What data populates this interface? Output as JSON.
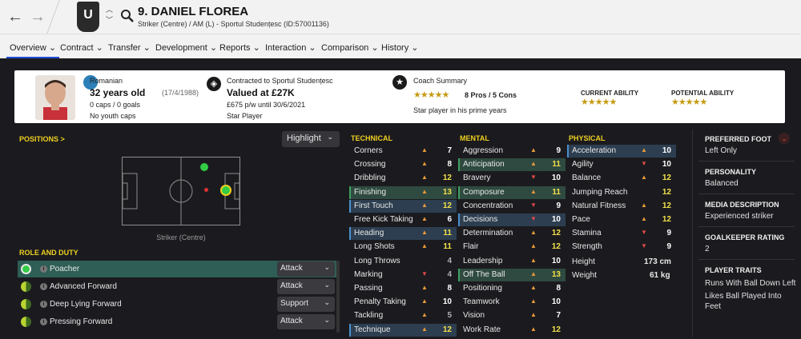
{
  "header": {
    "back_icon": "arrow-left-icon",
    "forward_icon": "arrow-right-icon",
    "club_badge_text": "U",
    "player_title": "9. DANIEL FLOREA",
    "player_subtitle": "Striker (Centre) / AM (L) - Sportul Studențesc (ID:57001136)"
  },
  "tabs": [
    {
      "label": "Overview ⌄",
      "active": true
    },
    {
      "label": "Contract ⌄"
    },
    {
      "label": "Transfer ⌄"
    },
    {
      "label": "Development ⌄"
    },
    {
      "label": "Reports ⌄"
    },
    {
      "label": "Interaction ⌄"
    },
    {
      "label": "Comparison ⌄"
    },
    {
      "label": "History ⌄"
    }
  ],
  "overview": {
    "nationality": "Romanian",
    "age": "32 years old",
    "dob": "(17/4/1988)",
    "caps": "0 caps / 0 goals",
    "youth_caps": "No youth caps",
    "contract_label": "Contracted to Sportul Studențesc",
    "value": "Valued at £27K",
    "wage": "£675 p/w until 30/6/2021",
    "status": "Star Player",
    "coach_label": "Coach Summary",
    "coach_stars": "★★★★★",
    "coach_pros_cons": "8 Pros / 5 Cons",
    "coach_text": "Star player in his prime years",
    "current_ability_label": "CURRENT ABILITY",
    "current_ability_stars": "★★★★★",
    "potential_ability_label": "POTENTIAL ABILITY",
    "potential_ability_stars": "★★★★★"
  },
  "positions": {
    "title": "POSITIONS >",
    "highlight_label": "Highlight",
    "pitch_caption": "Striker (Centre)"
  },
  "roles": {
    "title": "ROLE AND DUTY",
    "items": [
      {
        "name": "Poacher",
        "duty": "Attack"
      },
      {
        "name": "Advanced Forward",
        "duty": "Attack"
      },
      {
        "name": "Deep Lying Forward",
        "duty": "Support"
      },
      {
        "name": "Pressing Forward",
        "duty": "Attack"
      }
    ]
  },
  "technical": {
    "title": "TECHNICAL",
    "rows": [
      {
        "name": "Corners",
        "value": "7"
      },
      {
        "name": "Crossing",
        "value": "8"
      },
      {
        "name": "Dribbling",
        "value": "12"
      },
      {
        "name": "Finishing",
        "value": "13"
      },
      {
        "name": "First Touch",
        "value": "12"
      },
      {
        "name": "Free Kick Taking",
        "value": "6"
      },
      {
        "name": "Heading",
        "value": "11"
      },
      {
        "name": "Long Shots",
        "value": "11"
      },
      {
        "name": "Long Throws",
        "value": "4"
      },
      {
        "name": "Marking",
        "value": "4"
      },
      {
        "name": "Passing",
        "value": "8"
      },
      {
        "name": "Penalty Taking",
        "value": "10"
      },
      {
        "name": "Tackling",
        "value": "5"
      },
      {
        "name": "Technique",
        "value": "12"
      }
    ]
  },
  "mental": {
    "title": "MENTAL",
    "rows": [
      {
        "name": "Aggression",
        "value": "9"
      },
      {
        "name": "Anticipation",
        "value": "11"
      },
      {
        "name": "Bravery",
        "value": "10"
      },
      {
        "name": "Composure",
        "value": "11"
      },
      {
        "name": "Concentration",
        "value": "9"
      },
      {
        "name": "Decisions",
        "value": "10"
      },
      {
        "name": "Determination",
        "value": "12"
      },
      {
        "name": "Flair",
        "value": "12"
      },
      {
        "name": "Leadership",
        "value": "10"
      },
      {
        "name": "Off The Ball",
        "value": "13"
      },
      {
        "name": "Positioning",
        "value": "8"
      },
      {
        "name": "Teamwork",
        "value": "10"
      },
      {
        "name": "Vision",
        "value": "7"
      },
      {
        "name": "Work Rate",
        "value": "12"
      }
    ]
  },
  "physical": {
    "title": "PHYSICAL",
    "rows": [
      {
        "name": "Acceleration",
        "value": "10"
      },
      {
        "name": "Agility",
        "value": "10"
      },
      {
        "name": "Balance",
        "value": "12"
      },
      {
        "name": "Jumping Reach",
        "value": "12"
      },
      {
        "name": "Natural Fitness",
        "value": "12"
      },
      {
        "name": "Pace",
        "value": "12"
      },
      {
        "name": "Stamina",
        "value": "9"
      },
      {
        "name": "Strength",
        "value": "9"
      }
    ],
    "height_label": "Height",
    "height_value": "173 cm",
    "weight_label": "Weight",
    "weight_value": "61 kg"
  },
  "sidebar": {
    "preferred_foot_title": "PREFERRED FOOT",
    "preferred_foot": "Left Only",
    "personality_title": "PERSONALITY",
    "personality": "Balanced",
    "media_title": "MEDIA DESCRIPTION",
    "media": "Experienced striker",
    "gk_title": "GOALKEEPER RATING",
    "gk": "2",
    "traits_title": "PLAYER TRAITS",
    "trait_1": "Runs With Ball Down Left",
    "trait_2a": "Likes Ball Played Into",
    "trait_2b": "Feet"
  },
  "colors": {
    "accent_yellow": "#f0d020",
    "highlight_blue": "#2d3e50",
    "highlight_green": "#2f4a40",
    "active_role": "#2e5e55",
    "arrow_orange": "#e89a3a",
    "arrow_red": "#e04848"
  }
}
